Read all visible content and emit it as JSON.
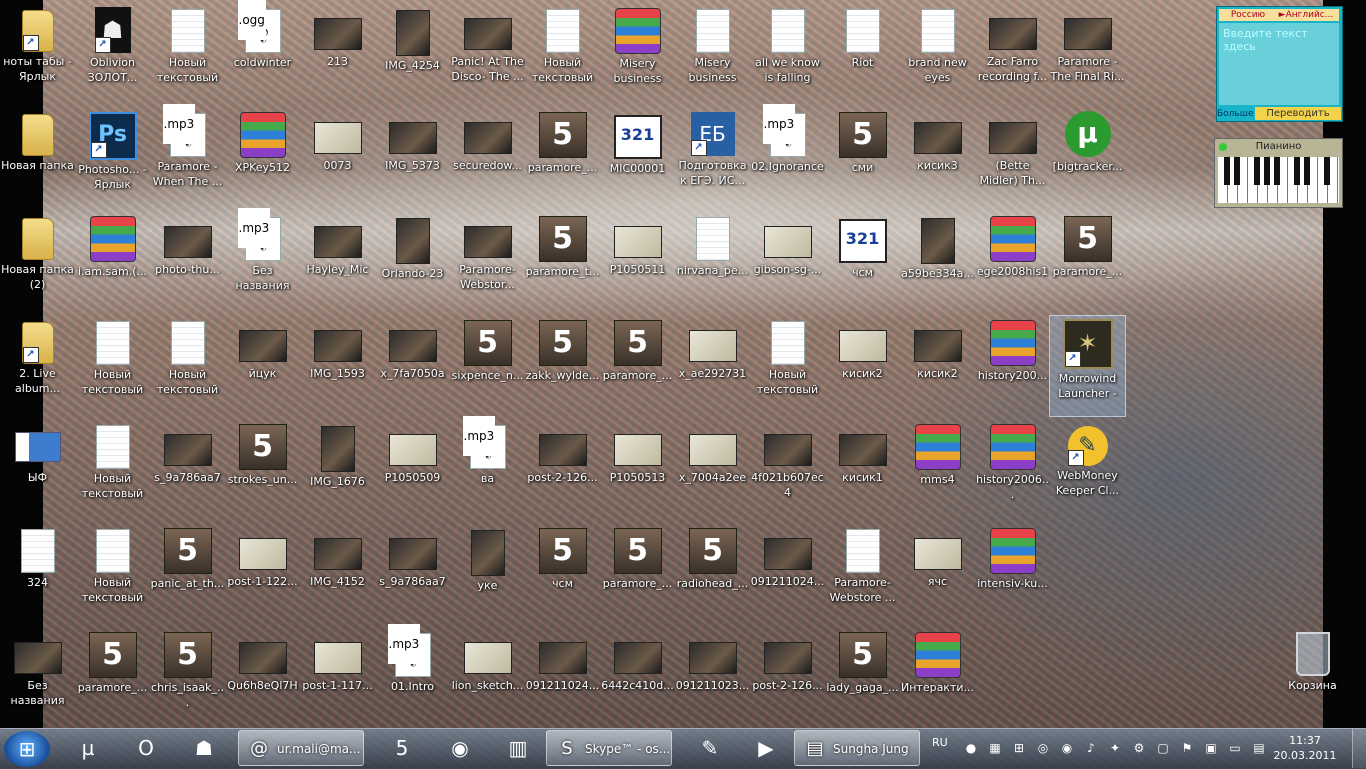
{
  "desktop": {
    "icons": [
      {
        "label": "ноты табы - Ярлык",
        "kind": "folder",
        "shortcut": true
      },
      {
        "label": "Oblivion ЗОЛОТ...",
        "kind": "ob",
        "shortcut": true
      },
      {
        "label": "Новый текстовый ...",
        "kind": "doc"
      },
      {
        "label": "coldwinter",
        "kind": "mp3",
        "ext": ".ogg"
      },
      {
        "label": "213",
        "kind": "img"
      },
      {
        "label": "IMG_4254",
        "kind": "img",
        "tall": true
      },
      {
        "label": "Panic! At The Disco- The ...",
        "kind": "img"
      },
      {
        "label": "Новый текстовый ...",
        "kind": "doc"
      },
      {
        "label": "Misery business",
        "kind": "rar"
      },
      {
        "label": "Misery business",
        "kind": "doc"
      },
      {
        "label": "all we know is falling",
        "kind": "doc"
      },
      {
        "label": "Riot",
        "kind": "doc"
      },
      {
        "label": "brand new eyes",
        "kind": "doc"
      },
      {
        "label": "Zac Farro recording f...",
        "kind": "img"
      },
      {
        "label": "Paramore - The Final Ri...",
        "kind": "img"
      },
      {
        "label": "Новая папка",
        "kind": "folder"
      },
      {
        "label": "Photosho... - Ярлык",
        "kind": "ps",
        "shortcut": true
      },
      {
        "label": "Paramore - When The ...",
        "kind": "mp3",
        "ext": ".mp3"
      },
      {
        "label": "XPKey512",
        "kind": "rar"
      },
      {
        "label": "0073",
        "kind": "img",
        "light": true
      },
      {
        "label": "IMG_5373",
        "kind": "img"
      },
      {
        "label": "securedow...",
        "kind": "img"
      },
      {
        "label": "paramore_...",
        "kind": "k5"
      },
      {
        "label": "MIC00001",
        "kind": "321"
      },
      {
        "label": "Подготовка к ЕГЭ. ИС...",
        "kind": "web",
        "shortcut": true
      },
      {
        "label": "02.Ignorance",
        "kind": "mp3",
        "ext": ".mp3"
      },
      {
        "label": "сми",
        "kind": "k5"
      },
      {
        "label": "кисик3",
        "kind": "img"
      },
      {
        "label": "(Bette Midler) Th...",
        "kind": "img"
      },
      {
        "label": "[bigtracker...",
        "kind": "ut"
      },
      {
        "label": "Новая папка (2)",
        "kind": "folder"
      },
      {
        "label": "i.am.sam.(...",
        "kind": "rar"
      },
      {
        "label": "photo-thu...",
        "kind": "img"
      },
      {
        "label": "Без названия",
        "kind": "mp3",
        "ext": ".mp3"
      },
      {
        "label": "Hayley_Mic",
        "kind": "img"
      },
      {
        "label": "Orlando-23",
        "kind": "img",
        "tall": true
      },
      {
        "label": "Paramore-Webstor...",
        "kind": "img"
      },
      {
        "label": "paramore_t...",
        "kind": "k5"
      },
      {
        "label": "P1050511",
        "kind": "img",
        "light": true
      },
      {
        "label": "nirvana_pe...",
        "kind": "doc"
      },
      {
        "label": "gibson-sg-...",
        "kind": "img",
        "light": true
      },
      {
        "label": "чсм",
        "kind": "321"
      },
      {
        "label": "a59be334a...",
        "kind": "img",
        "tall": true
      },
      {
        "label": "ege2008his1",
        "kind": "rar"
      },
      {
        "label": "paramore_...",
        "kind": "k5"
      },
      {
        "label": "2. Live album...",
        "kind": "folder",
        "shortcut": true
      },
      {
        "label": "Новый текстовый ...",
        "kind": "doc"
      },
      {
        "label": "Новый текстовый ...",
        "kind": "doc"
      },
      {
        "label": "йцук",
        "kind": "img"
      },
      {
        "label": "IMG_1593",
        "kind": "img"
      },
      {
        "label": "x_7fa7050a",
        "kind": "img"
      },
      {
        "label": "sixpence_n...",
        "kind": "k5"
      },
      {
        "label": "zakk_wylde...",
        "kind": "k5"
      },
      {
        "label": "paramore_...",
        "kind": "k5"
      },
      {
        "label": "x_ae292731",
        "kind": "img",
        "light": true
      },
      {
        "label": "Новый текстовый ...",
        "kind": "doc"
      },
      {
        "label": "кисик2",
        "kind": "img",
        "light": true
      },
      {
        "label": "кисик2",
        "kind": "img"
      },
      {
        "label": "history200...",
        "kind": "rar"
      },
      {
        "label": "Morrowind Launcher - Ярлык",
        "kind": "mw",
        "shortcut": true,
        "selected": true
      },
      {
        "label": "ЫФ",
        "kind": "screen"
      },
      {
        "label": "Новый текстовый ...",
        "kind": "doc"
      },
      {
        "label": "s_9a786aa7",
        "kind": "img"
      },
      {
        "label": "strokes_un...",
        "kind": "k5"
      },
      {
        "label": "IMG_1676",
        "kind": "img",
        "tall": true
      },
      {
        "label": "P1050509",
        "kind": "img",
        "light": true
      },
      {
        "label": "ва",
        "kind": "mp3",
        "ext": ".mp3"
      },
      {
        "label": "post-2-126...",
        "kind": "img"
      },
      {
        "label": "P1050513",
        "kind": "img",
        "light": true
      },
      {
        "label": "x_7004a2ee",
        "kind": "img",
        "light": true
      },
      {
        "label": "4f021b607ec4",
        "kind": "img"
      },
      {
        "label": "кисик1",
        "kind": "img"
      },
      {
        "label": "mms4",
        "kind": "rar"
      },
      {
        "label": "history2006...",
        "kind": "rar"
      },
      {
        "label": "WebMoney Keeper Cl...",
        "kind": "wm",
        "shortcut": true
      },
      {
        "label": "324",
        "kind": "doc"
      },
      {
        "label": "Новый текстовый ...",
        "kind": "doc"
      },
      {
        "label": "panic_at_th...",
        "kind": "k5"
      },
      {
        "label": "post-1-122...",
        "kind": "img",
        "light": true
      },
      {
        "label": "IMG_4152",
        "kind": "img"
      },
      {
        "label": "s_9a786aa7",
        "kind": "img"
      },
      {
        "label": "уке",
        "kind": "img",
        "tall": true
      },
      {
        "label": "чсм",
        "kind": "k5"
      },
      {
        "label": "paramore_...",
        "kind": "k5"
      },
      {
        "label": "radiohead_...",
        "kind": "k5"
      },
      {
        "label": "091211024...",
        "kind": "img"
      },
      {
        "label": "Paramore-Webstore ...",
        "kind": "doc"
      },
      {
        "label": "ячс",
        "kind": "img",
        "light": true
      },
      {
        "label": "intensiv-ku...",
        "kind": "rar"
      },
      null,
      {
        "label": "Без названия",
        "kind": "img"
      },
      {
        "label": "paramore_...",
        "kind": "k5"
      },
      {
        "label": "chris_isaak_...",
        "kind": "k5"
      },
      {
        "label": "Qu6h8eQl7H",
        "kind": "img"
      },
      {
        "label": "post-1-117...",
        "kind": "img",
        "light": true
      },
      {
        "label": "01.Intro",
        "kind": "mp3",
        "ext": ".mp3"
      },
      {
        "label": "lion_sketch...",
        "kind": "img",
        "light": true
      },
      {
        "label": "091211024...",
        "kind": "img"
      },
      {
        "label": "6442c410d...",
        "kind": "img"
      },
      {
        "label": "091211023...",
        "kind": "img"
      },
      {
        "label": "post-2-126...",
        "kind": "img"
      },
      {
        "label": "lady_gaga_...",
        "kind": "k5"
      },
      {
        "label": "Интеракти...",
        "kind": "rar"
      },
      null,
      null
    ],
    "recycle_bin": {
      "label": "Корзина"
    }
  },
  "translator_widget": {
    "from_lang": "Россию",
    "to_lang": "►Английс...",
    "placeholder": "Введите текст здесь",
    "more": "Больше",
    "translate_button": "Переводить"
  },
  "piano_widget": {
    "title": "Пианино"
  },
  "taskbar": {
    "pinned": [
      {
        "name": "utorrent-pinned",
        "glyph": "µ"
      },
      {
        "name": "opera-pinned",
        "glyph": "O"
      },
      {
        "name": "oblivion-pinned",
        "glyph": "☗"
      }
    ],
    "windows": [
      {
        "name": "mail-agent-window",
        "glyph": "@",
        "label": "ur.mali@ma..."
      },
      {
        "name": "skype-window",
        "glyph": "S",
        "label": "Skype™ - os..."
      },
      {
        "name": "folder-window",
        "glyph": "▤",
        "label": "Sungha Jung"
      }
    ],
    "language": "RU",
    "clock": {
      "time": "11:37",
      "date": "20.03.2011"
    }
  },
  "colors": {
    "taskbar": "#3c4a5c",
    "selection": "#96bee6",
    "utorrent": "#2b9a2f"
  }
}
